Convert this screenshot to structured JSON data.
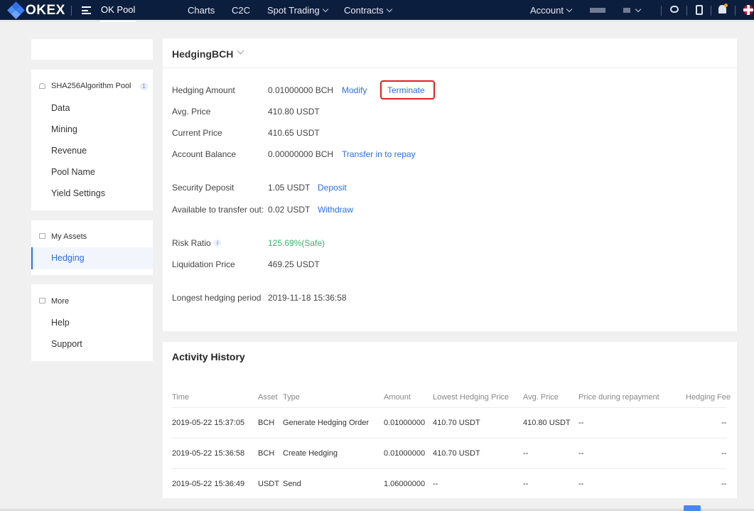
{
  "nav": {
    "logo": "OKEX",
    "pool_tab": "OK Pool",
    "links": [
      "Charts",
      "C2C",
      "Spot Trading",
      "Contracts"
    ],
    "account": "Account"
  },
  "sidebar": {
    "pool_group": {
      "title": "SHA256Algorithm Pool",
      "badge": "1",
      "items": [
        "Data",
        "Mining",
        "Revenue",
        "Pool Name",
        "Yield Settings"
      ]
    },
    "assets_group": {
      "title": "My Assets",
      "active_item": "Hedging"
    },
    "more_group": {
      "title": "More",
      "items": [
        "Help",
        "Support"
      ]
    }
  },
  "hedging": {
    "title": "HedgingBCH",
    "amount_label": "Hedging Amount",
    "amount_value": "0.01000000 BCH",
    "modify_link": "Modify",
    "terminate_link": "Terminate",
    "avg_price_label": "Avg. Price",
    "avg_price_value": "410.80 USDT",
    "current_price_label": "Current Price",
    "current_price_value": "410.65 USDT",
    "account_balance_label": "Account Balance",
    "account_balance_value": "0.00000000 BCH",
    "transfer_link": "Transfer in to repay",
    "security_deposit_label": "Security Deposit",
    "security_deposit_value": "1.05 USDT",
    "deposit_link": "Deposit",
    "available_label": "Available to transfer out:",
    "available_value": "0.02 USDT",
    "withdraw_link": "Withdraw",
    "risk_ratio_label": "Risk Ratio",
    "risk_ratio_value": "125.69%(Safe)",
    "liquidation_label": "Liquidation Price",
    "liquidation_value": "469.25 USDT",
    "longest_label": "Longest hedging period",
    "longest_value": "2019-11-18 15:36:58"
  },
  "activity": {
    "title": "Activity History",
    "columns": [
      "Time",
      "Asset",
      "Type",
      "Amount",
      "Lowest Hedging Price",
      "Avg. Price",
      "Price during repayment",
      "Hedging Fee"
    ],
    "rows": [
      [
        "2019-05-22 15:37:05",
        "BCH",
        "Generate Hedging Order",
        "0.01000000",
        "410.70 USDT",
        "410.80 USDT",
        "--",
        "--"
      ],
      [
        "2019-05-22 15:36:58",
        "BCH",
        "Create Hedging",
        "0.01000000",
        "410.70 USDT",
        "--",
        "--",
        "--"
      ],
      [
        "2019-05-22 15:36:49",
        "USDT",
        "Send",
        "1.06000000",
        "--",
        "--",
        "--",
        "--"
      ]
    ]
  },
  "colors": {
    "nav_bg": "#0c1e3e",
    "link": "#2a6ff0",
    "safe_green": "#3ab36b",
    "highlight_red": "#e02020"
  }
}
